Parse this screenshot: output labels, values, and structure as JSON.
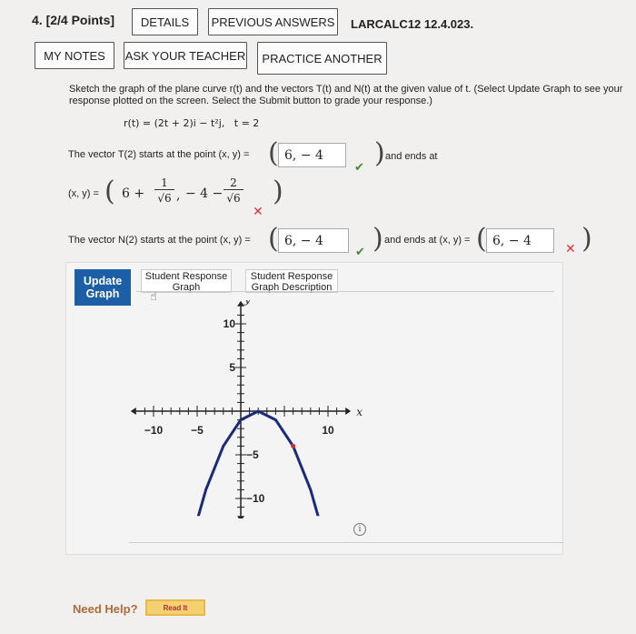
{
  "question": {
    "number_label": "4.",
    "points_label": "[2/4 Points]",
    "code": "LARCALC12 12.4.023."
  },
  "top_buttons": {
    "details": "DETAILS",
    "previous_answers": "PREVIOUS ANSWERS",
    "my_notes": "MY NOTES",
    "ask_teacher": "ASK YOUR TEACHER",
    "practice_another": "PRACTICE ANOTHER"
  },
  "instructions": "Sketch the graph of the plane curve r(t) and the vectors T(t) and N(t) at the given value of t. (Select Update Graph to see your response plotted on the screen. Select the Submit button to grade your response.)",
  "curve": {
    "r_text": "r(t) = (2t + 2)i − t²j,",
    "t_text": "t = 2"
  },
  "tangent": {
    "start_label": "The vector T(2) starts at the point (x, y) =",
    "start_value": "6, − 4",
    "start_status": "correct",
    "ends_label": "and ends at",
    "end_prefix": "(x, y) =",
    "end_expr": {
      "a": "6 +",
      "frac1_num": "1",
      "frac1_den": "√6",
      "sep": ",",
      "b": "− 4 −",
      "frac2_num": "2",
      "frac2_den": "√6"
    },
    "end_status": "incorrect"
  },
  "normal": {
    "start_label": "The vector N(2) starts at the point (x, y) =",
    "start_value": "6, − 4",
    "start_status": "correct",
    "ends_label": "and ends at (x, y) =",
    "end_value": "6, − 4",
    "end_status": "incorrect"
  },
  "graph_panel": {
    "update_label": "Update Graph",
    "tab_student_response": "Student Response Graph",
    "tab_description": "Student Response Graph Description"
  },
  "chart_data": {
    "type": "line",
    "xlabel": "x",
    "ylabel": "y",
    "xlim": [
      -12,
      12
    ],
    "ylim": [
      -12,
      12
    ],
    "x_ticks_labeled": [
      -10,
      -5,
      10
    ],
    "y_ticks_labeled": [
      10,
      5,
      -5,
      -10
    ],
    "series": [
      {
        "x": [
          -6,
          -4,
          -2,
          0,
          2,
          4,
          6,
          8,
          10
        ],
        "y": [
          -16,
          -9,
          -4,
          -1,
          0,
          -1,
          -4,
          -9,
          -16
        ]
      }
    ],
    "points": [
      {
        "x": 6,
        "y": -4
      }
    ],
    "colors": {
      "curve": "#1b2a7a",
      "axes": "#222",
      "point": "#c0392b"
    }
  },
  "help": {
    "need_help": "Need Help?",
    "read_it": "Read It"
  }
}
